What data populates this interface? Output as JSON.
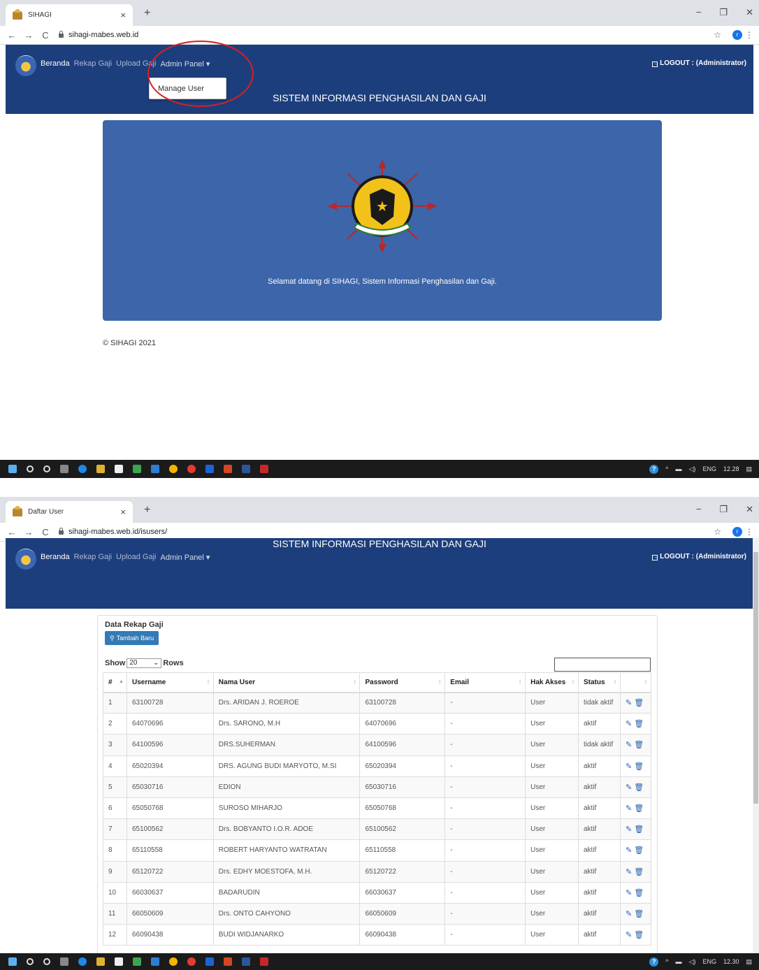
{
  "screen1": {
    "browser": {
      "tab_title": "SIHAGI",
      "tab_close": "×",
      "new_tab": "+",
      "url": "sihagi-mabes.web.id",
      "profile_initial": "r"
    },
    "nav": {
      "home": "Beranda",
      "rekap": "Rekap Gaji",
      "upload": "Upload Gaji",
      "admin": "Admin Panel ▾",
      "logout": "LOGOUT : (Administrator)"
    },
    "dropdown_item": "Manage User",
    "banner_title": "SISTEM INFORMASI PENGHASILAN DAN GAJI",
    "welcome": "Selamat datang di SIHAGI, Sistem Informasi Penghasilan dan Gaji.",
    "footer": "© SIHAGI 2021",
    "taskbar": {
      "lang": "ENG",
      "time": "12.28"
    }
  },
  "screen2": {
    "browser": {
      "tab_title": "Daftar User",
      "tab_close": "×",
      "new_tab": "+",
      "url": "sihagi-mabes.web.id/isusers/",
      "profile_initial": "r"
    },
    "nav": {
      "home": "Beranda",
      "rekap": "Rekap Gaji",
      "upload": "Upload Gaji",
      "admin": "Admin Panel ▾",
      "logout": "LOGOUT : (Administrator)"
    },
    "banner_title": "SISTEM INFORMASI PENGHASILAN DAN GAJI",
    "panel_title": "Data Rekap Gaji",
    "add_button": "Tambah Baru",
    "show_label": "Show",
    "show_value": "20",
    "rows_label": "Rows",
    "columns": [
      "#",
      "Username",
      "Nama User",
      "Password",
      "Email",
      "Hak Akses",
      "Status",
      ""
    ],
    "rows": [
      [
        "1",
        "63100728",
        "Drs. ARIDAN J. ROEROE",
        "63100728",
        "-",
        "User",
        "tidak aktif"
      ],
      [
        "2",
        "64070696",
        "Drs. SARONO, M.H",
        "64070696",
        "-",
        "User",
        "aktif"
      ],
      [
        "3",
        "64100596",
        "DRS.SUHERMAN",
        "64100596",
        "-",
        "User",
        "tidak aktif"
      ],
      [
        "4",
        "65020394",
        "DRS. AGUNG BUDI MARYOTO, M.SI",
        "65020394",
        "-",
        "User",
        "aktif"
      ],
      [
        "5",
        "65030716",
        "EDION",
        "65030716",
        "-",
        "User",
        "aktif"
      ],
      [
        "6",
        "65050768",
        "SUROSO MIHARJO",
        "65050768",
        "-",
        "User",
        "aktif"
      ],
      [
        "7",
        "65100562",
        "Drs. BOBYANTO I.O.R. ADOE",
        "65100562",
        "-",
        "User",
        "aktif"
      ],
      [
        "8",
        "65110558",
        "ROBERT HARYANTO WATRATAN",
        "65110558",
        "-",
        "User",
        "aktif"
      ],
      [
        "9",
        "65120722",
        "Drs. EDHY MOESTOFA, M.H.",
        "65120722",
        "-",
        "User",
        "aktif"
      ],
      [
        "10",
        "66030637",
        "BADARUDIN",
        "66030637",
        "-",
        "User",
        "aktif"
      ],
      [
        "11",
        "66050609",
        "Drs. ONTO CAHYONO",
        "66050609",
        "-",
        "User",
        "aktif"
      ],
      [
        "12",
        "66090438",
        "BUDI WIDJANARKO",
        "66090438",
        "-",
        "User",
        "aktif"
      ]
    ],
    "taskbar": {
      "lang": "ENG",
      "time": "12.30"
    }
  },
  "colors": {
    "navbar": "#1d3e7c",
    "jumbotron": "#3d65a9",
    "button": "#337ab7",
    "annotation": "#d62020"
  }
}
